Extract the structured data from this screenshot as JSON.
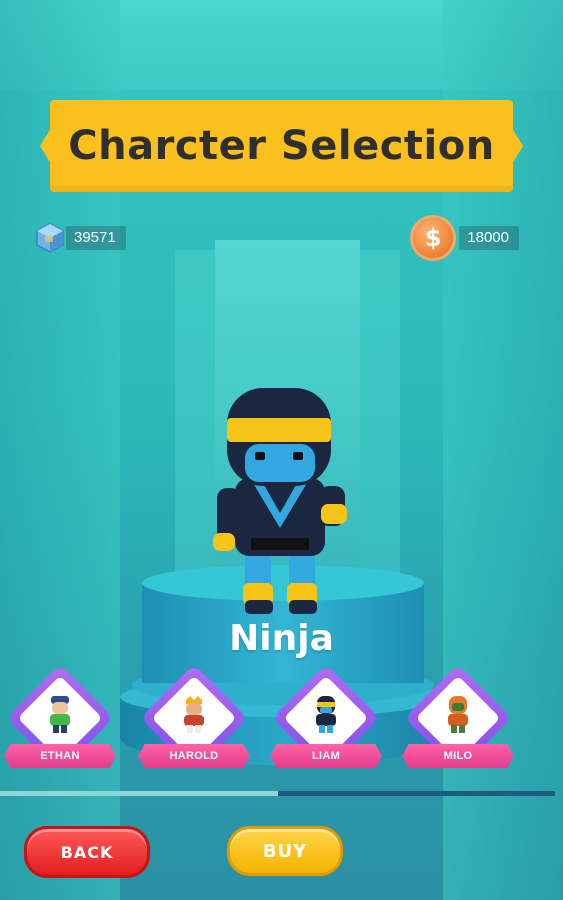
{
  "title": "Charcter Selection",
  "currency": {
    "gems": "39571",
    "coins": "18000",
    "gem_icon": "gem-icon",
    "coin_icon": "coin-icon",
    "coin_symbol": "$"
  },
  "selected_character": {
    "name": "Ninja"
  },
  "characters": [
    {
      "name": "ETHAN",
      "icon": "ethan-avatar"
    },
    {
      "name": "HAROLD",
      "icon": "harold-avatar"
    },
    {
      "name": "LIAM",
      "icon": "liam-avatar"
    },
    {
      "name": "MILO",
      "icon": "milo-avatar"
    }
  ],
  "scroll_position": 0.5,
  "buttons": {
    "back": "BACK",
    "buy": "BUY"
  },
  "colors": {
    "background": "#35c6c2",
    "banner": "#fbbf1e",
    "back_button": "#e21d1d",
    "buy_button": "#f5b400",
    "card_label": "#e23c8b",
    "card_frame": "#7b4ee8"
  }
}
